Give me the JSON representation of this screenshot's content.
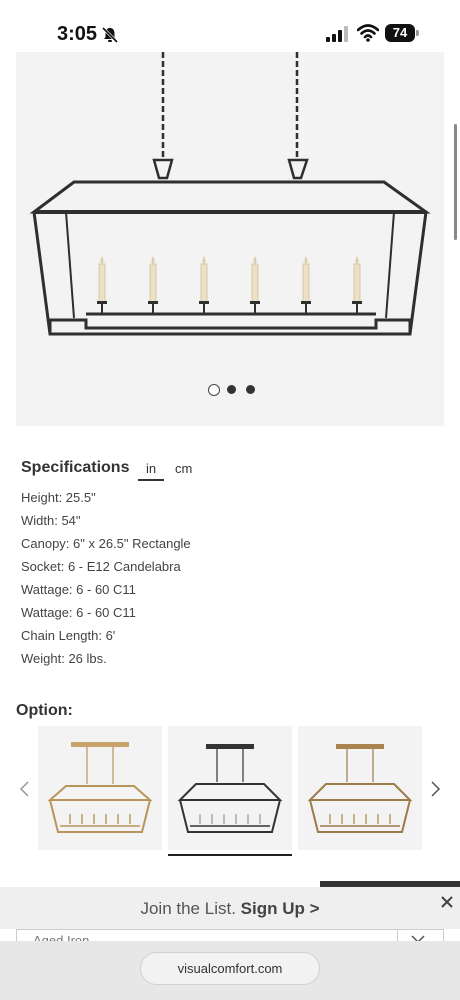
{
  "status_bar": {
    "time": "3:05",
    "battery": "74"
  },
  "hero": {
    "carousel_count": 3,
    "active_index": 0
  },
  "specifications": {
    "title": "Specifications",
    "unit_in": "in",
    "unit_cm": "cm",
    "lines": [
      "Height: 25.5\"",
      "Width: 54\"",
      "Canopy: 6\" x 26.5\" Rectangle",
      "Socket: 6 - E12 Candelabra",
      "Wattage: 6 - 60 C11",
      "Wattage: 6 - 60 C11",
      "Chain Length: 6'",
      "Weight: 26 lbs."
    ]
  },
  "option": {
    "label": "Option:",
    "selected_index": 1
  },
  "join_banner": {
    "text": "Join the List.",
    "cta": "Sign Up >"
  },
  "select": {
    "value": "Aged Iron"
  },
  "browser": {
    "url": "visualcomfort.com"
  },
  "icons": [
    "bell-slash-icon",
    "signal-icon",
    "wifi-icon",
    "battery-icon",
    "chevron-left-icon",
    "chevron-right-icon",
    "close-icon",
    "chevron-down-icon"
  ]
}
